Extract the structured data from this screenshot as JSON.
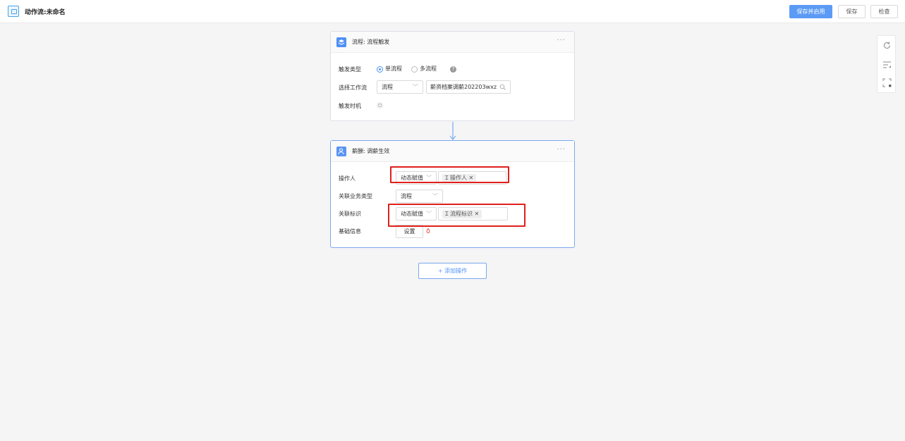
{
  "header": {
    "title": "动作流:未命名",
    "save_enable_label": "保存并启用",
    "save_label": "保存",
    "check_label": "检查"
  },
  "trigger_card": {
    "title": "流程: 流程触发",
    "more": "···",
    "trigger_type_label": "触发类型",
    "radio_single": "单流程",
    "radio_multi": "多流程",
    "help": "?",
    "workflow_label": "选择工作流",
    "workflow_type_value": "流程",
    "workflow_value": "薪资档案调薪202203wxz",
    "timing_label": "触发时机"
  },
  "action_card": {
    "title": "薪酬: 调薪生效",
    "more": "···",
    "operator_label": "操作人",
    "operator_mode": "动态赋值",
    "operator_tag": "操作人",
    "business_type_label": "关联业务类型",
    "business_type_value": "流程",
    "relation_id_label": "关联标识",
    "relation_id_mode": "动态赋值",
    "relation_id_tag": "流程标识",
    "basic_info_label": "基础信息",
    "set_button": "设置"
  },
  "add_action_label": "+ 添加操作",
  "colors": {
    "primary": "#5b9bf5",
    "highlight": "#e0201b"
  }
}
